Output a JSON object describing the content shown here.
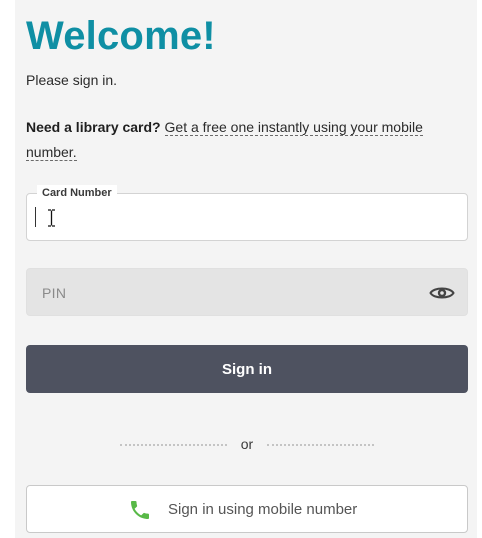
{
  "header": {
    "title": "Welcome!",
    "subtitle": "Please sign in."
  },
  "library_card": {
    "prompt": "Need a library card?",
    "link_text": "Get a free one instantly using your mobile number."
  },
  "form": {
    "card_number": {
      "label": "Card Number",
      "value": ""
    },
    "pin": {
      "placeholder": "PIN",
      "icon": "eye-icon"
    },
    "sign_in_label": "Sign in",
    "divider_text": "or",
    "mobile_sign_in": {
      "label": "Sign in using mobile number",
      "icon": "phone-icon"
    }
  },
  "colors": {
    "title": "#0f8fa4",
    "sign_in_button": "#4e5260",
    "phone_icon": "#58b947",
    "panel_background": "#f4f4f4",
    "pin_background": "#e4e4e4"
  }
}
